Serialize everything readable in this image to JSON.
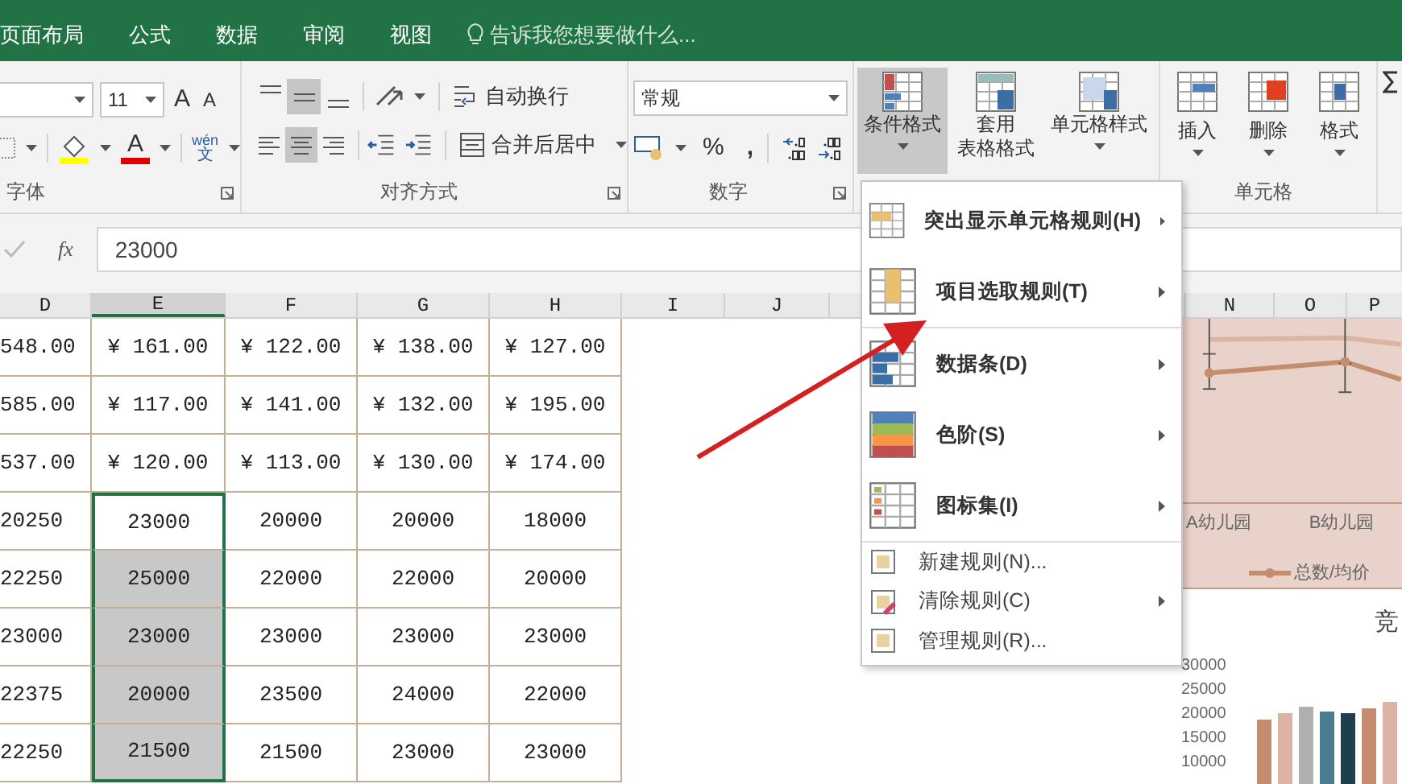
{
  "tabs": [
    {
      "label": "页面布局",
      "selected": false
    },
    {
      "label": "公式",
      "selected": false
    },
    {
      "label": "数据",
      "selected": false
    },
    {
      "label": "审阅",
      "selected": false
    },
    {
      "label": "视图",
      "selected": false
    }
  ],
  "tell_me": {
    "placeholder": "告诉我您想要做什么..."
  },
  "ribbon": {
    "font": {
      "size": "11",
      "grow": "A",
      "shrink": "A",
      "font_color": "A",
      "phonetic_top": "wén",
      "phonetic_bottom": "文",
      "label": "字体"
    },
    "alignment": {
      "vertical": [
        {
          "selected": false
        },
        {
          "selected": true
        },
        {
          "selected": false
        }
      ],
      "horizontal": [
        {
          "selected": false
        },
        {
          "selected": true
        },
        {
          "selected": false
        }
      ],
      "wrap": "自动换行",
      "merge": "合并后居中",
      "label": "对齐方式"
    },
    "number": {
      "format": "常规",
      "percent": "%",
      "comma": ",",
      "label": "数字"
    },
    "styles": [
      {
        "label": [
          "条件格式"
        ],
        "selected": true
      },
      {
        "label": [
          "套用",
          "表格格式"
        ],
        "selected": false
      },
      {
        "label": [
          "单元格样式"
        ],
        "selected": false
      }
    ],
    "cells": {
      "buttons": [
        "插入",
        "删除",
        "格式"
      ],
      "label": "单元格"
    }
  },
  "formula_bar": {
    "fx": "fx",
    "value": "23000"
  },
  "sheet": {
    "columns": [
      {
        "label": "D",
        "selected": false
      },
      {
        "label": "E",
        "selected": true
      },
      {
        "label": "F",
        "selected": false
      },
      {
        "label": "G",
        "selected": false
      },
      {
        "label": "H",
        "selected": false
      },
      {
        "label": "I",
        "selected": false
      },
      {
        "label": "J",
        "selected": false
      }
    ],
    "right_columns": [
      "N",
      "O",
      "P"
    ],
    "rows": [
      [
        {
          "text": "548.00",
          "selected": false,
          "active": false
        },
        {
          "text": "¥ 161.00",
          "selected": false,
          "active": false
        },
        {
          "text": "¥ 122.00",
          "selected": false,
          "active": false
        },
        {
          "text": "¥ 138.00",
          "selected": false,
          "active": false
        },
        {
          "text": "¥ 127.00",
          "selected": false,
          "active": false
        }
      ],
      [
        {
          "text": "585.00",
          "selected": false,
          "active": false
        },
        {
          "text": "¥ 117.00",
          "selected": false,
          "active": false
        },
        {
          "text": "¥ 141.00",
          "selected": false,
          "active": false
        },
        {
          "text": "¥ 132.00",
          "selected": false,
          "active": false
        },
        {
          "text": "¥ 195.00",
          "selected": false,
          "active": false
        }
      ],
      [
        {
          "text": "537.00",
          "selected": false,
          "active": false
        },
        {
          "text": "¥ 120.00",
          "selected": false,
          "active": false
        },
        {
          "text": "¥ 113.00",
          "selected": false,
          "active": false
        },
        {
          "text": "¥ 130.00",
          "selected": false,
          "active": false
        },
        {
          "text": "¥ 174.00",
          "selected": false,
          "active": false
        }
      ],
      [
        {
          "text": "20250",
          "selected": false,
          "active": false
        },
        {
          "text": "23000",
          "selected": false,
          "active": true
        },
        {
          "text": "20000",
          "selected": false,
          "active": false
        },
        {
          "text": "20000",
          "selected": false,
          "active": false
        },
        {
          "text": "18000",
          "selected": false,
          "active": false
        }
      ],
      [
        {
          "text": "22250",
          "selected": false,
          "active": false
        },
        {
          "text": "25000",
          "selected": true,
          "active": false
        },
        {
          "text": "22000",
          "selected": false,
          "active": false
        },
        {
          "text": "22000",
          "selected": false,
          "active": false
        },
        {
          "text": "20000",
          "selected": false,
          "active": false
        }
      ],
      [
        {
          "text": "23000",
          "selected": false,
          "active": false
        },
        {
          "text": "23000",
          "selected": true,
          "active": false
        },
        {
          "text": "23000",
          "selected": false,
          "active": false
        },
        {
          "text": "23000",
          "selected": false,
          "active": false
        },
        {
          "text": "23000",
          "selected": false,
          "active": false
        }
      ],
      [
        {
          "text": "22375",
          "selected": false,
          "active": false
        },
        {
          "text": "20000",
          "selected": true,
          "active": false
        },
        {
          "text": "23500",
          "selected": false,
          "active": false
        },
        {
          "text": "24000",
          "selected": false,
          "active": false
        },
        {
          "text": "22000",
          "selected": false,
          "active": false
        }
      ],
      [
        {
          "text": "22250",
          "selected": false,
          "active": false
        },
        {
          "text": "21500",
          "selected": true,
          "active": false
        },
        {
          "text": "21500",
          "selected": false,
          "active": false
        },
        {
          "text": "23000",
          "selected": false,
          "active": false
        },
        {
          "text": "23000",
          "selected": false,
          "active": false
        }
      ]
    ]
  },
  "menu": {
    "sections": [
      [
        {
          "label": "突出显示单元格规则(H)",
          "kind": "large",
          "submenu": true
        },
        {
          "label": "项目选取规则(T)",
          "kind": "large",
          "submenu": true
        }
      ],
      [
        {
          "label": "数据条(D)",
          "kind": "large",
          "submenu": true
        },
        {
          "label": "色阶(S)",
          "kind": "large",
          "submenu": true
        },
        {
          "label": "图标集(I)",
          "kind": "large",
          "submenu": true
        }
      ],
      [
        {
          "label": "新建规则(N)...",
          "kind": "small",
          "submenu": false
        },
        {
          "label": "清除规则(C)",
          "kind": "small",
          "submenu": true
        },
        {
          "label": "管理规则(R)...",
          "kind": "small",
          "submenu": false
        }
      ]
    ]
  },
  "chart": {
    "categories": [
      "A幼儿园",
      "B幼儿园"
    ],
    "legend": "总数/均价"
  },
  "chart2": {
    "title": "竞",
    "y_labels": [
      "30000",
      "25000",
      "20000",
      "15000",
      "10000"
    ]
  }
}
